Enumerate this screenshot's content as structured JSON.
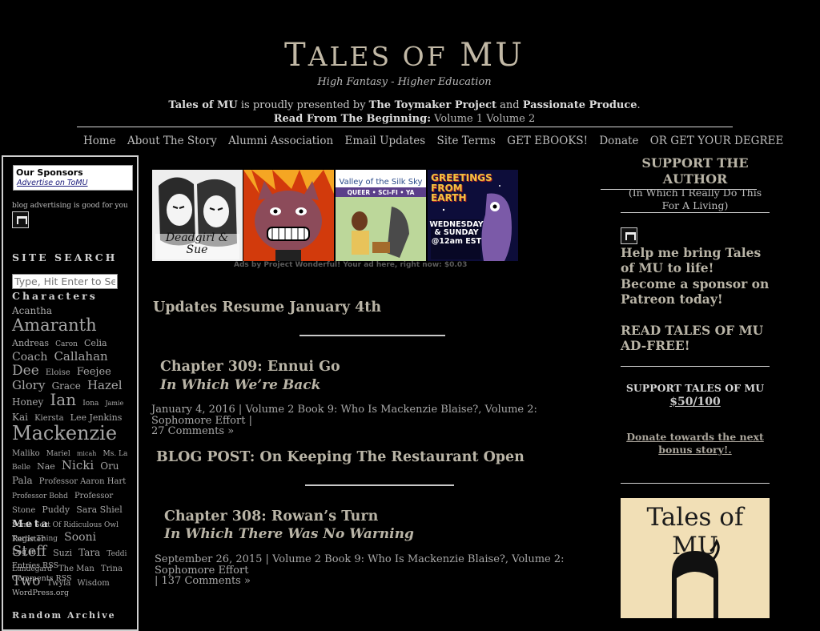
{
  "header": {
    "title_first": "T",
    "title_rest": "ALES OF",
    "title_end": " MU",
    "tagline": "High Fantasy - Higher Education",
    "present_name": "Tales of MU",
    "present_mid": " is proudly presented by ",
    "present_a": "The Toymaker Project",
    "present_and": " and ",
    "present_b": "Passionate Produce",
    "present_end": ".",
    "readfrom_label": "Read From The Beginning:",
    "vol1": "Volume 1",
    "vol2": "Volume 2"
  },
  "nav": [
    "Home",
    "About The Story",
    "Alumni Association",
    "Email Updates",
    "Site Terms",
    "GET EBOOKS!",
    "Donate",
    "OR GET YOUR DEGREE"
  ],
  "left": {
    "sponsors_title": "Our Sponsors",
    "sponsors_link": "Advertise on ToMU",
    "blog_ad": "blog advertising is good for you",
    "search_heading": "SITE SEARCH",
    "search_placeholder": "Type, Hit Enter to Search",
    "characters_heading": "Characters",
    "tags": [
      {
        "t": "Acantha",
        "s": 12
      },
      {
        "t": "Amaranth",
        "s": 21
      },
      {
        "t": "Andreas",
        "s": 11
      },
      {
        "t": "Caron",
        "s": 9
      },
      {
        "t": "Celia",
        "s": 11
      },
      {
        "t": "Coach",
        "s": 14
      },
      {
        "t": "Callahan",
        "s": 15
      },
      {
        "t": "Dee",
        "s": 17
      },
      {
        "t": "Eloise",
        "s": 10
      },
      {
        "t": "Feejee",
        "s": 13
      },
      {
        "t": "Glory",
        "s": 15
      },
      {
        "t": "Grace",
        "s": 12
      },
      {
        "t": "Hazel",
        "s": 15
      },
      {
        "t": "Honey",
        "s": 12
      },
      {
        "t": "Ian",
        "s": 20
      },
      {
        "t": "Iona",
        "s": 9
      },
      {
        "t": "Jamie",
        "s": 8
      },
      {
        "t": "Kai",
        "s": 12
      },
      {
        "t": "Kiersta",
        "s": 10
      },
      {
        "t": "Lee Jenkins",
        "s": 11
      },
      {
        "t": "Mackenzie",
        "s": 24
      },
      {
        "t": "Maliko",
        "s": 10
      },
      {
        "t": "Mariel",
        "s": 9
      },
      {
        "t": "micah",
        "s": 8
      },
      {
        "t": "Ms. La Belle",
        "s": 9
      },
      {
        "t": "Nae",
        "s": 11
      },
      {
        "t": "Nicki",
        "s": 15
      },
      {
        "t": "Oru",
        "s": 12
      },
      {
        "t": "Pala",
        "s": 12
      },
      {
        "t": "Professor Aaron Hart",
        "s": 10
      },
      {
        "t": "Professor Bohd",
        "s": 9
      },
      {
        "t": "Professor Stone",
        "s": 10
      },
      {
        "t": "Puddy",
        "s": 11
      },
      {
        "t": "Sara Shiel",
        "s": 11
      },
      {
        "t": "Some Sort Of Ridiculous Owl Turtle Thing",
        "s": 9
      },
      {
        "t": "Sooni",
        "s": 14
      },
      {
        "t": "Steff",
        "s": 18
      },
      {
        "t": "Suzi",
        "s": 11
      },
      {
        "t": "Tara",
        "s": 12
      },
      {
        "t": "Teddi Lundegard",
        "s": 9
      },
      {
        "t": "The Man",
        "s": 10
      },
      {
        "t": "Trina",
        "s": 10
      },
      {
        "t": "Two",
        "s": 17
      },
      {
        "t": "Twyla",
        "s": 10
      },
      {
        "t": "Wisdom",
        "s": 10
      }
    ],
    "meta_heading": "Meta",
    "meta": [
      "Register",
      "Log in",
      "Entries RSS",
      "Comments RSS",
      "WordPress.org"
    ],
    "random_heading": "Random Archive"
  },
  "ads": {
    "ad1_text": "Deadgirl & Sue",
    "ad3_title": "Valley of the Silk Sky",
    "ad3_tags": "QUEER • SCI-FI • YA",
    "ad4_title": "GREETINGS FROM EARTH",
    "ad4_days": "WEDNESDAY & SUNDAY @12am EST",
    "caption": "Ads by Project Wonderful! Your ad here, right now: $0.03"
  },
  "main": {
    "post1_title": "Updates Resume January 4th",
    "post2_title": "Chapter 309: Ennui Go",
    "post2_sub": "In Which We’re Back",
    "post2_date": "January 4, 2016",
    "post2_cats": "Volume 2 Book 9: Who Is Mackenzie Blaise?, Volume 2: Sophomore Effort",
    "post2_comments": "27 Comments »",
    "post3_title": "BLOG POST: On Keeping The Restaurant Open",
    "post4_title": "Chapter 308: Rowan’s Turn",
    "post4_sub": "In Which There Was No Warning",
    "post4_date": "September 26, 2015",
    "post4_cats": "Volume 2 Book 9: Who Is Mackenzie Blaise?, Volume 2: Sophomore Effort",
    "post4_comments": "137 Comments »"
  },
  "right": {
    "support_heading": "SUPPORT THE AUTHOR",
    "support_sub": "(In Which I Really Do This For A Living)",
    "patreon": "Help me bring Tales of MU to life! Become a sponsor on Patreon today!",
    "adfree": "READ TALES OF MU AD-FREE!",
    "support_mu": "SUPPORT TALES OF MU",
    "amount": "$50/100",
    "donate_next": "Donate towards the next bonus story!.",
    "book_title": "Tales of MU"
  },
  "colors": {
    "background": "#000000",
    "heading": "#b9b4a6",
    "text": "#c0c0c0"
  }
}
